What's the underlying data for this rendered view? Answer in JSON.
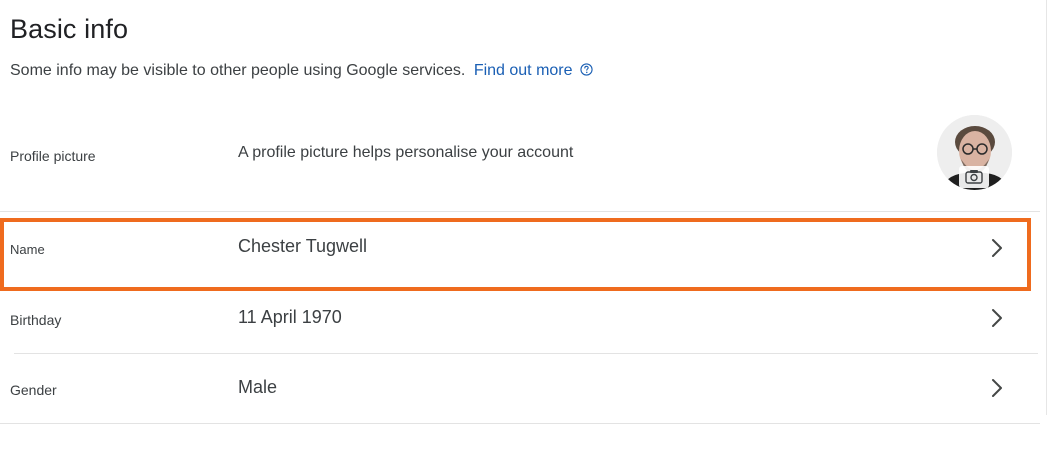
{
  "section": {
    "title": "Basic info",
    "subtitle": "Some info may be visible to other people using Google services.",
    "link_label": "Find out more",
    "help_icon": "help-circle-icon"
  },
  "rows": {
    "profile": {
      "label": "Profile picture",
      "description": "A profile picture helps personalise your account",
      "avatar_icon": "avatar",
      "badge_icon": "camera-icon"
    },
    "name": {
      "label": "Name",
      "value": "Chester Tugwell",
      "chevron_icon": "chevron-right-icon"
    },
    "birthday": {
      "label": "Birthday",
      "value": "11 April 1970",
      "chevron_icon": "chevron-right-icon"
    },
    "gender": {
      "label": "Gender",
      "value": "Male",
      "chevron_icon": "chevron-right-icon"
    }
  },
  "colors": {
    "link": "#1a5fb4",
    "highlight": "#ef6b1e",
    "divider": "#e3e3e3",
    "text": "#3c4043"
  }
}
